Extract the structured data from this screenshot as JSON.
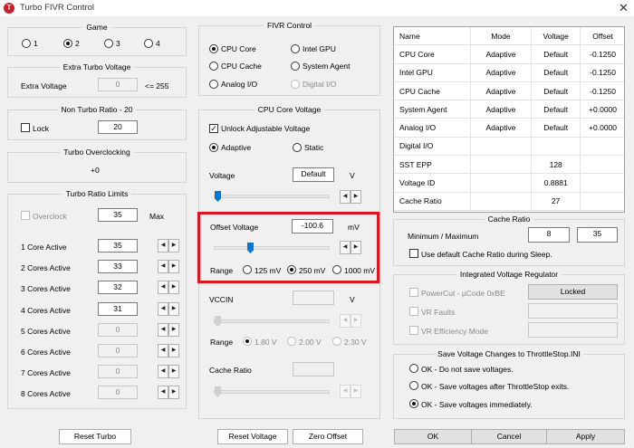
{
  "window": {
    "title": "Turbo FIVR Control",
    "icon_glyph": "T",
    "close": "✕"
  },
  "game": {
    "title": "Game",
    "options": [
      "1",
      "2",
      "3",
      "4"
    ],
    "selected": "2"
  },
  "extra_turbo": {
    "title": "Extra Turbo Voltage",
    "label": "Extra Voltage",
    "value": "0",
    "note": "<= 255"
  },
  "non_turbo": {
    "title": "Non Turbo Ratio - 20",
    "lock_label": "Lock",
    "value": "20"
  },
  "turbo_oc": {
    "title": "Turbo Overclocking",
    "value": "+0"
  },
  "ratio_limits": {
    "title": "Turbo Ratio Limits",
    "overclock_label": "Overclock",
    "overclock_value": "35",
    "max_label": "Max",
    "rows": [
      {
        "label": "1 Core Active",
        "value": "35"
      },
      {
        "label": "2 Cores Active",
        "value": "33"
      },
      {
        "label": "3 Cores Active",
        "value": "32"
      },
      {
        "label": "4 Cores Active",
        "value": "31"
      },
      {
        "label": "5 Cores Active",
        "value": "0"
      },
      {
        "label": "6 Cores Active",
        "value": "0"
      },
      {
        "label": "7 Cores Active",
        "value": "0"
      },
      {
        "label": "8 Cores Active",
        "value": "0"
      }
    ]
  },
  "fivr": {
    "title": "FIVR Control",
    "planes": [
      "CPU Core",
      "Intel GPU",
      "CPU Cache",
      "System Agent",
      "Analog I/O",
      "Digital I/O"
    ],
    "selected": "CPU Core"
  },
  "core_voltage": {
    "title": "CPU Core Voltage",
    "unlock_label": "Unlock Adjustable Voltage",
    "unlock_check": "✓",
    "mode_adaptive": "Adaptive",
    "mode_static": "Static",
    "voltage_label": "Voltage",
    "voltage_value": "Default",
    "voltage_unit": "V",
    "offset_label": "Offset Voltage",
    "offset_value": "-100.6",
    "offset_unit": "mV",
    "range_label": "Range",
    "ranges": [
      "125 mV",
      "250 mV",
      "1000 mV"
    ],
    "range_selected": "250 mV",
    "vccin_label": "VCCIN",
    "vccin_value": "",
    "vccin_unit": "V",
    "vccin_ranges": [
      "1.80 V",
      "2.00 V",
      "2.30 V"
    ],
    "cache_ratio_label": "Cache Ratio",
    "cache_ratio_value": ""
  },
  "status_table": {
    "headers": [
      "Name",
      "Mode",
      "Voltage",
      "Offset"
    ],
    "rows": [
      [
        "CPU Core",
        "Adaptive",
        "Default",
        "-0.1250"
      ],
      [
        "Intel GPU",
        "Adaptive",
        "Default",
        "-0.1250"
      ],
      [
        "CPU Cache",
        "Adaptive",
        "Default",
        "-0.1250"
      ],
      [
        "System Agent",
        "Adaptive",
        "Default",
        "+0.0000"
      ],
      [
        "Analog I/O",
        "Adaptive",
        "Default",
        "+0.0000"
      ],
      [
        "Digital I/O",
        "",
        "",
        ""
      ]
    ],
    "extras": [
      {
        "label": "SST EPP",
        "value": "128"
      },
      {
        "label": "Voltage ID",
        "value": "0.8881"
      },
      {
        "label": "Cache Ratio",
        "value": "27"
      }
    ]
  },
  "cache_ratio": {
    "title": "Cache Ratio",
    "minmax_label": "Minimum / Maximum",
    "min": "8",
    "max": "35",
    "default_label": "Use default Cache Ratio during Sleep."
  },
  "ivr": {
    "title": "Integrated Voltage Regulator",
    "powercut_label": "PowerCut  -  µCode 0xBE",
    "locked_label": "Locked",
    "vr_faults_label": "VR Faults",
    "vr_eff_label": "VR Efficiency Mode"
  },
  "save": {
    "title": "Save Voltage Changes to ThrottleStop.INI",
    "options": [
      "OK - Do not save voltages.",
      "OK - Save voltages after ThrottleStop exits.",
      "OK - Save voltages immediately."
    ],
    "selected": "OK - Save voltages immediately."
  },
  "buttons": {
    "reset_turbo": "Reset Turbo",
    "reset_voltage": "Reset Voltage",
    "zero_offset": "Zero Offset",
    "ok": "OK",
    "cancel": "Cancel",
    "apply": "Apply"
  },
  "spin_glyphs": {
    "left": "◀",
    "right": "▶"
  },
  "colors": {
    "highlight": "#e0141e",
    "slider_thumb": "#0078d7",
    "app_icon": "#c8202a"
  }
}
